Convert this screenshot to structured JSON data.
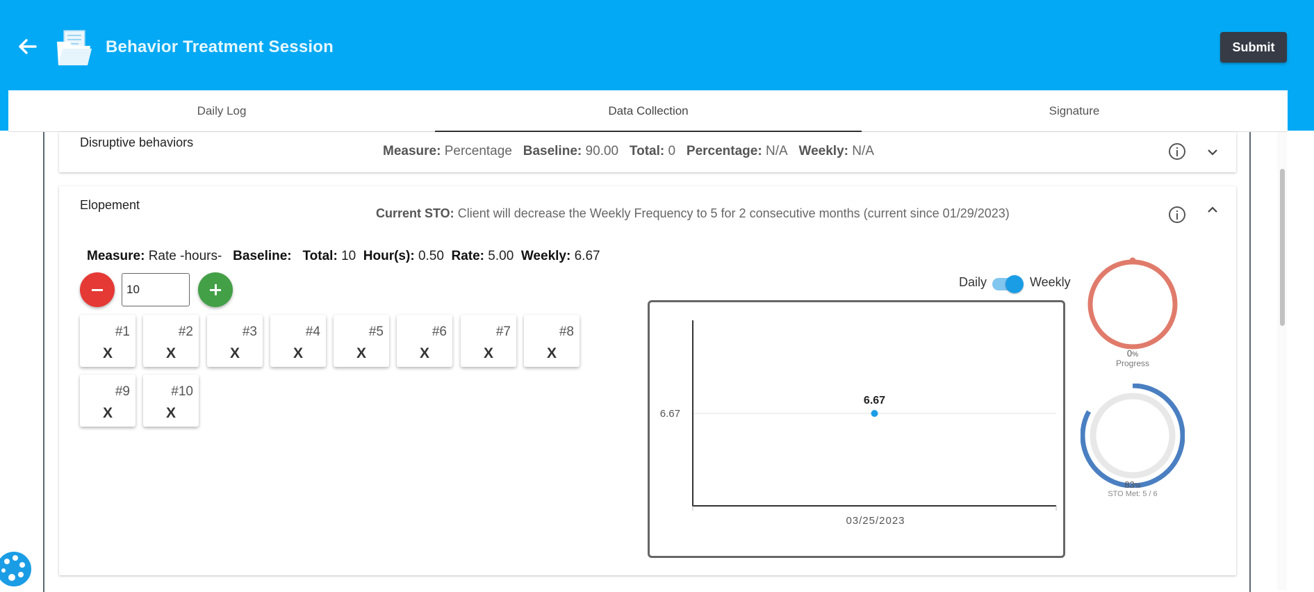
{
  "header": {
    "title": "Behavior Treatment Session",
    "submit_label": "Submit",
    "bg_color": "#03a9f4"
  },
  "tabs": [
    {
      "label": "Daily Log",
      "active": false
    },
    {
      "label": "Data Collection",
      "active": true
    },
    {
      "label": "Signature",
      "active": false
    }
  ],
  "behavior1": {
    "name": "Disruptive behaviors",
    "measure_label": "Measure:",
    "measure_value": "Percentage",
    "baseline_label": "Baseline:",
    "baseline_value": "90.00",
    "total_label": "Total:",
    "total_value": "0",
    "percentage_label": "Percentage:",
    "percentage_value": "N/A",
    "weekly_label": "Weekly:",
    "weekly_value": "N/A"
  },
  "behavior2": {
    "name": "Elopement",
    "sto_label": "Current STO:",
    "sto_text": "Client will decrease the Weekly Frequency to 5 for 2 consecutive months (current since 01/29/2023)",
    "measure_label": "Measure:",
    "measure_value": "Rate -hours-",
    "baseline_label": "Baseline:",
    "total_label": "Total:",
    "total_value": "10",
    "hours_label": "Hour(s):",
    "hours_value": "0.50",
    "rate_label": "Rate:",
    "rate_value": "5.00",
    "weekly_label": "Weekly:",
    "weekly_value": "6.67",
    "count_input": "10",
    "tiles": [
      {
        "num": "#1",
        "mark": "X"
      },
      {
        "num": "#2",
        "mark": "X"
      },
      {
        "num": "#3",
        "mark": "X"
      },
      {
        "num": "#4",
        "mark": "X"
      },
      {
        "num": "#5",
        "mark": "X"
      },
      {
        "num": "#6",
        "mark": "X"
      },
      {
        "num": "#7",
        "mark": "X"
      },
      {
        "num": "#8",
        "mark": "X"
      },
      {
        "num": "#9",
        "mark": "X"
      },
      {
        "num": "#10",
        "mark": "X"
      }
    ],
    "toggle": {
      "left_label": "Daily",
      "right_label": "Weekly",
      "selected": "Weekly"
    },
    "progress": {
      "value_text": "0",
      "pct_sign": "%",
      "label": "Progress",
      "fraction": 0,
      "color": "#e07b6b"
    },
    "sto_met": {
      "value_text": "83",
      "pct_sign": "%",
      "label": "STO Met: 5 / 6",
      "fraction": 0.83,
      "color": "#4a7fc1"
    }
  },
  "chart_data": {
    "type": "scatter",
    "x": [
      "03/25/2023"
    ],
    "y": [
      6.67
    ],
    "data_labels": [
      "6.67"
    ],
    "y_ticks": [
      "6.67"
    ],
    "x_ticks": [
      "03/25/2023"
    ],
    "point_color": "#1b9de6"
  }
}
